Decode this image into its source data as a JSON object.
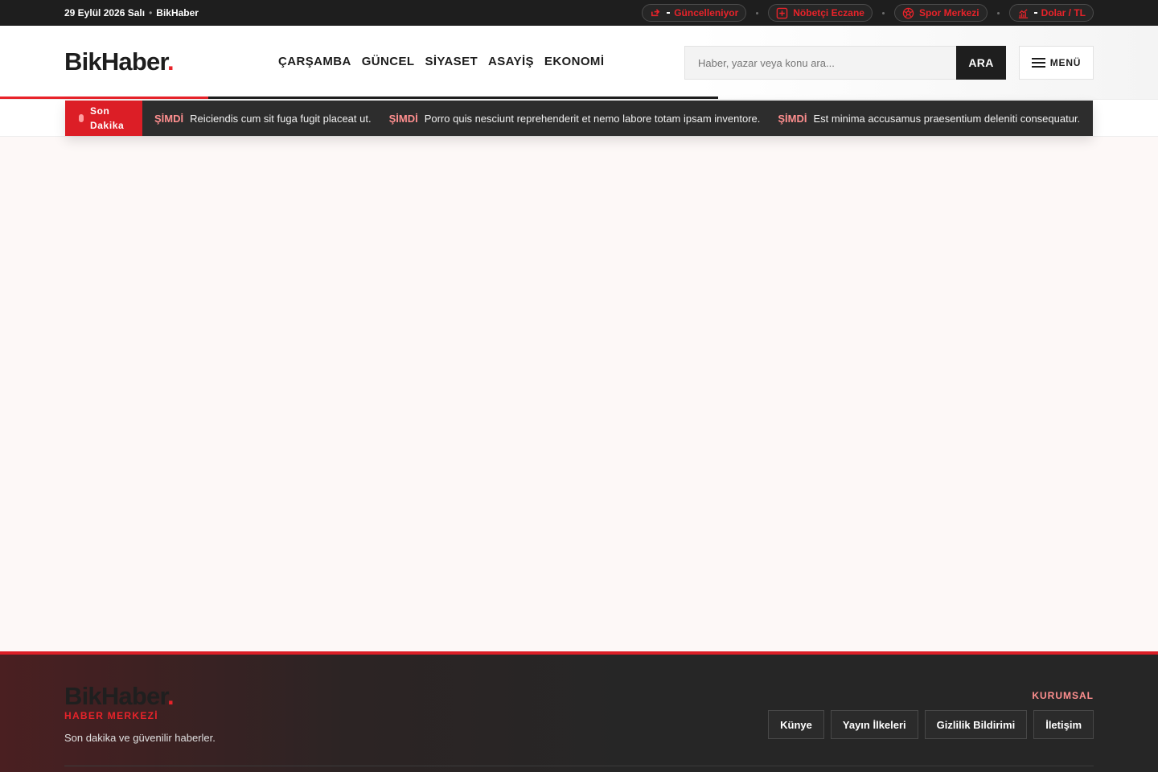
{
  "topbar": {
    "date": "29 Eylül 2026 Salı",
    "site_name": "BikHaber",
    "pills": [
      {
        "label": "Güncelleniyor",
        "icon": "refresh-icon"
      },
      {
        "label": "Nöbetçi Eczane",
        "icon": "pharmacy-cross-icon"
      },
      {
        "label": "Spor Merkezi",
        "icon": "soccer-ball-icon"
      },
      {
        "label": "Dolar / TL",
        "icon": "chart-icon"
      }
    ]
  },
  "header": {
    "logo_text": "BikHaber",
    "logo_dot": ".",
    "nav": [
      "ÇARŞAMBA",
      "GÜNCEL",
      "SİYASET",
      "ASAYİŞ",
      "EKONOMİ"
    ],
    "search_placeholder": "Haber, yazar veya konu ara...",
    "search_button": "ARA",
    "menu_label": "MENÜ"
  },
  "breaking": {
    "label": "Son Dakika",
    "tag": "ŞİMDİ",
    "items": [
      "Reiciendis cum sit fuga fugit placeat ut.",
      "Porro quis nesciunt reprehenderit et nemo labore totam ipsam inventore.",
      "Est minima accusamus praesentium deleniti consequatur."
    ]
  },
  "footer": {
    "logo_text": "BikHaber",
    "logo_dot": ".",
    "subtitle": "HABER MERKEZİ",
    "description": "Son dakika ve güvenilir haberler.",
    "section_title": "KURUMSAL",
    "links": [
      "Künye",
      "Yayın İlkeleri",
      "Gizlilik Bildirimi",
      "İletişim"
    ]
  },
  "colors": {
    "accent": "#e8232a",
    "dark": "#1e1e1e",
    "background": "#fdf8f7"
  }
}
